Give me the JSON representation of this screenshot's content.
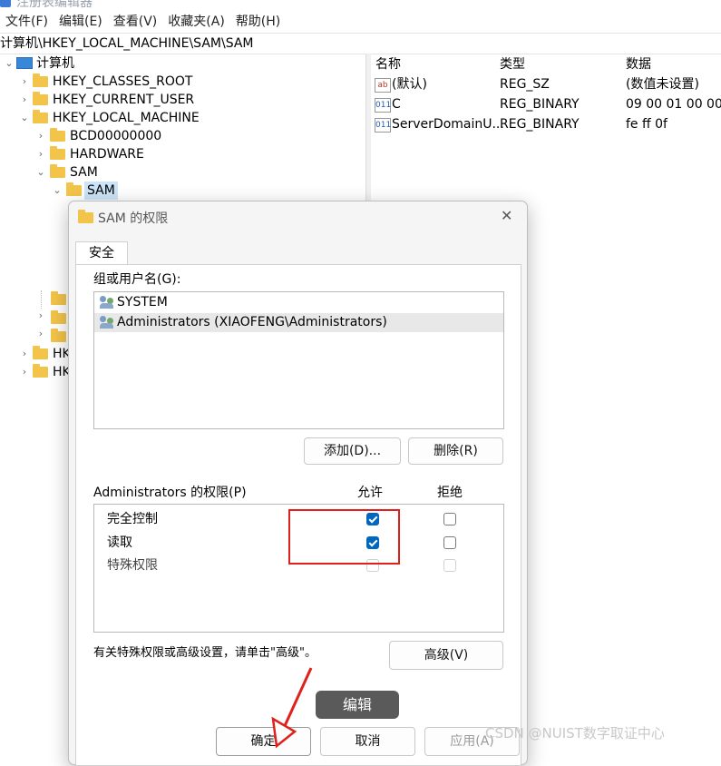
{
  "app": {
    "title": "注册表编辑器"
  },
  "menu": [
    "文件(F)",
    "编辑(E)",
    "查看(V)",
    "收藏夹(A)",
    "帮助(H)"
  ],
  "address": "计算机\\HKEY_LOCAL_MACHINE\\SAM\\SAM",
  "tree": {
    "root": "计算机",
    "items": [
      "HKEY_CLASSES_ROOT",
      "HKEY_CURRENT_USER",
      "HKEY_LOCAL_MACHINE",
      "BCD00000000",
      "HARDWARE",
      "SAM",
      "SAM"
    ],
    "partial": [
      "HK",
      "HK"
    ]
  },
  "list": {
    "headers": {
      "name": "名称",
      "type": "类型",
      "data": "数据"
    },
    "rows": [
      {
        "icon": "ab",
        "name": "(默认)",
        "type": "REG_SZ",
        "data": "(数值未设置)"
      },
      {
        "icon": "011",
        "name": "C",
        "type": "REG_BINARY",
        "data": "09 00 01 00 00"
      },
      {
        "icon": "011",
        "name": "ServerDomainU...",
        "type": "REG_BINARY",
        "data": "fe ff 0f"
      }
    ]
  },
  "dialog": {
    "title": "SAM 的权限",
    "close": "✕",
    "tab": "安全",
    "group_label": "组或用户名(G):",
    "principals": [
      "SYSTEM",
      "Administrators (XIAOFENG\\Administrators)"
    ],
    "add_label": "添加(D)...",
    "remove_label": "删除(R)",
    "perm_label": "Administrators 的权限(P)",
    "allow_label": "允许",
    "deny_label": "拒绝",
    "perms": [
      {
        "name": "完全控制",
        "allow": true,
        "deny": false,
        "disabled": false
      },
      {
        "name": "读取",
        "allow": true,
        "deny": false,
        "disabled": false
      },
      {
        "name": "特殊权限",
        "allow": false,
        "deny": false,
        "disabled": true
      }
    ],
    "advanced_hint": "有关特殊权限或高级设置，请单击\"高级\"。",
    "advanced_label": "高级(V)",
    "ok_label": "确定",
    "cancel_label": "取消",
    "apply_label": "应用(A)"
  },
  "annotation": {
    "label": "编辑",
    "highlight_color": "#e0211b"
  },
  "watermark": "CSDN @NUIST数字取证中心",
  "colors": {
    "accent": "#0067c0",
    "selection": "#cce4f7",
    "folder": "#f3c44a"
  }
}
